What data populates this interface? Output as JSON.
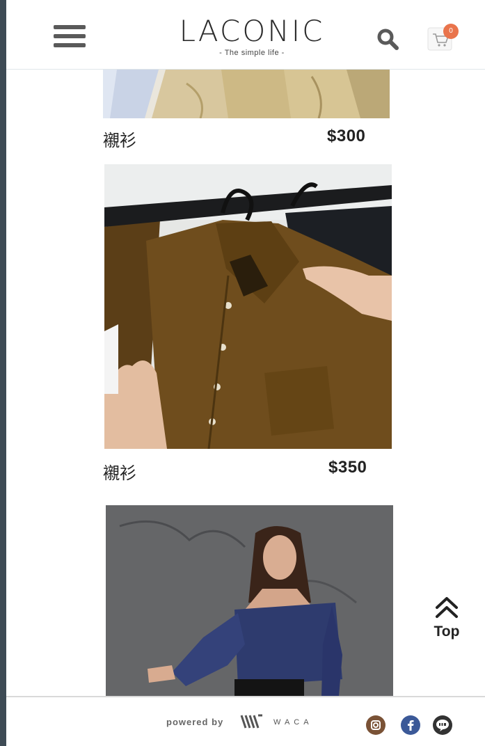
{
  "header": {
    "logo_title": "LACONIC",
    "logo_subtitle": "- The simple life -",
    "cart_count": "0"
  },
  "products": [
    {
      "name": "襯衫",
      "price": "$300",
      "image": "beige-shirts-on-rack-photo"
    },
    {
      "name": "襯衫",
      "price": "$350",
      "image": "brown-shirt-on-hanger-photo"
    },
    {
      "name": "",
      "price": "",
      "image": "woman-in-blue-off-shoulder-top-photo"
    }
  ],
  "back_to_top": {
    "label": "Top"
  },
  "footer": {
    "powered_by": "powered by",
    "brand": "WACA",
    "social": [
      "instagram-icon",
      "facebook-icon",
      "line-icon"
    ]
  },
  "colors": {
    "accent_badge": "#e9744c",
    "facebook": "#3b5998",
    "instagram": "#7a5236",
    "line": "#333333",
    "icon_gray": "#5a5a5a"
  },
  "icons": [
    "hamburger-menu-icon",
    "search-icon",
    "cart-icon",
    "chevrons-up-icon"
  ]
}
